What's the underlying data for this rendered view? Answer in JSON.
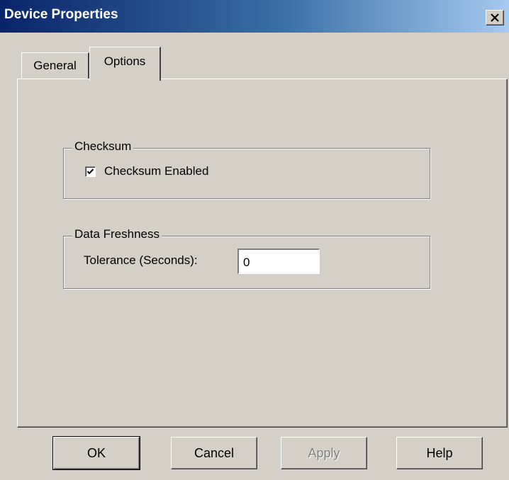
{
  "window": {
    "title": "Device Properties",
    "close_glyph": "✕"
  },
  "tabs": [
    {
      "label": "General",
      "active": false
    },
    {
      "label": "Options",
      "active": true
    }
  ],
  "checksum_group": {
    "legend": "Checksum",
    "checkbox_label": "Checksum Enabled",
    "checked": true
  },
  "freshness_group": {
    "legend": "Data Freshness",
    "tolerance_label": "Tolerance (Seconds):",
    "tolerance_value": "0"
  },
  "buttons": {
    "ok": "OK",
    "cancel": "Cancel",
    "apply": "Apply",
    "help": "Help"
  },
  "colors": {
    "dialog_face": "#d4d0c8",
    "title_gradient_start": "#0a246a",
    "title_gradient_end": "#a6caf0",
    "disabled_text": "#808080"
  }
}
